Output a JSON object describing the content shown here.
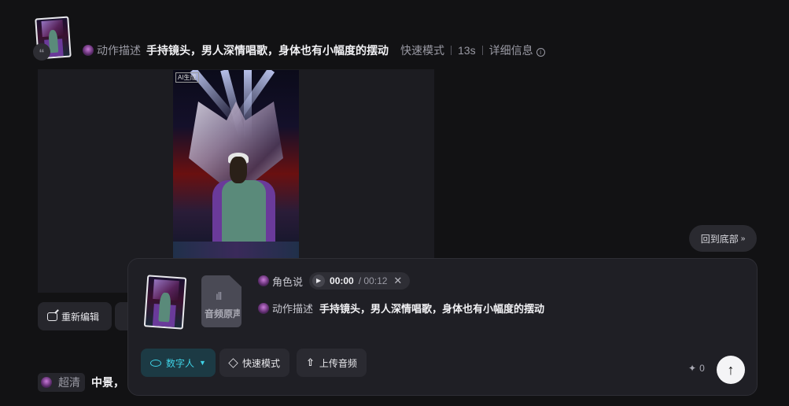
{
  "header": {
    "action_label": "动作描述",
    "action_text": "手持镜头，男人深情唱歌，身体也有小幅度的摆动",
    "mode": "快速模式",
    "duration": "13s",
    "details_label": "详细信息"
  },
  "video": {
    "watermark": "AI生成"
  },
  "actions": {
    "re_edit_label": "重新编辑"
  },
  "next_item": {
    "quality_label": "超清",
    "text_prefix": "中景，"
  },
  "back_to_bottom_label": "回到底部",
  "composer": {
    "audio_card_label": "音频原声",
    "role_say_label": "角色说",
    "audio_current": "00:00",
    "audio_total": "/ 00:12",
    "action_label": "动作描述",
    "action_text": "手持镜头，男人深情唱歌，身体也有小幅度的摆动",
    "digital_human_label": "数字人",
    "fast_mode_label": "快速模式",
    "upload_audio_label": "上传音频",
    "credits": "0"
  },
  "colors": {
    "accent": "#3fd2e6",
    "background": "#121214",
    "panel": "#1f1f25"
  }
}
